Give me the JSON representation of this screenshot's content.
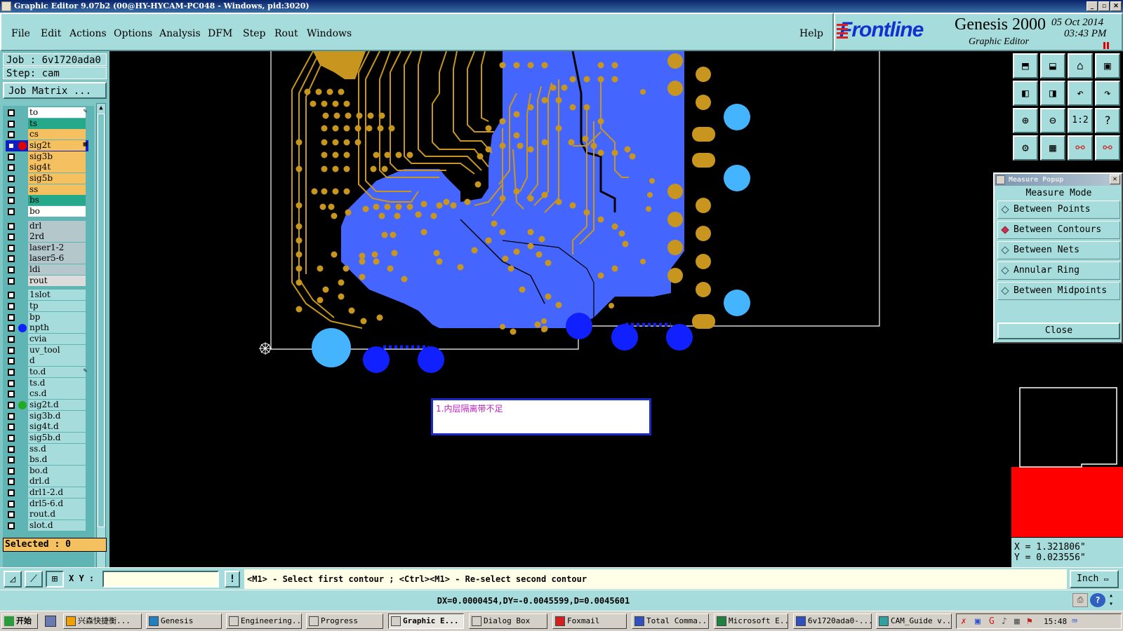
{
  "title_bar": {
    "text": "Graphic Editor 9.07b2 (00@HY-HYCAM-PC048 - Windows, pid:3020)"
  },
  "menu": {
    "items": [
      "File",
      "Edit",
      "Actions",
      "Options",
      "Analysis",
      "DFM",
      "Step",
      "Rout",
      "Windows"
    ],
    "help": "Help"
  },
  "logo": {
    "brand": "Frontline",
    "product": "Genesis 2000",
    "subtitle": "Graphic Editor",
    "date": "05 Oct 2014",
    "time": "03:43 PM"
  },
  "job": {
    "job_label": "Job : 6v1720ada0",
    "step_label": "Step: cam",
    "matrix_button": "Job Matrix ..."
  },
  "layers": [
    {
      "name": "to",
      "color": "#ffffff",
      "dot": null,
      "mark": "pen"
    },
    {
      "name": "ts",
      "color": "#26a88a",
      "dot": null
    },
    {
      "name": "cs",
      "color": "#f4c060",
      "dot": null
    },
    {
      "name": "sig2t",
      "color": "#f4c060",
      "dot": "#e00000",
      "mark": "grid",
      "work": true
    },
    {
      "name": "sig3b",
      "color": "#f4c060",
      "dot": null
    },
    {
      "name": "sig4t",
      "color": "#f4c060",
      "dot": null
    },
    {
      "name": "sig5b",
      "color": "#f4c060",
      "dot": null
    },
    {
      "name": "ss",
      "color": "#f4c060",
      "dot": null
    },
    {
      "name": "bs",
      "color": "#26a88a",
      "dot": null
    },
    {
      "name": "bo",
      "color": "#ffffff",
      "dot": null
    },
    {
      "name": "drl",
      "color": "#b4c8cc",
      "dot": null,
      "gap": true
    },
    {
      "name": "2rd",
      "color": "#b4c8cc",
      "dot": null
    },
    {
      "name": "laser1-2",
      "color": "#b4c8cc",
      "dot": null
    },
    {
      "name": "laser5-6",
      "color": "#b4c8cc",
      "dot": null
    },
    {
      "name": "ldi",
      "color": "#b4c8cc",
      "dot": null
    },
    {
      "name": "rout",
      "color": "#dcdcdc",
      "dot": null
    },
    {
      "name": "1slot",
      "color": "#a6dcdc",
      "dot": null,
      "gap": true
    },
    {
      "name": "tp",
      "color": "#a6dcdc",
      "dot": null
    },
    {
      "name": "bp",
      "color": "#a6dcdc",
      "dot": null
    },
    {
      "name": "npth",
      "color": "#a6dcdc",
      "dot": "#1020ff"
    },
    {
      "name": "cvia",
      "color": "#a6dcdc",
      "dot": null
    },
    {
      "name": "uv_tool",
      "color": "#a6dcdc",
      "dot": null
    },
    {
      "name": "d",
      "color": "#a6dcdc",
      "dot": null
    },
    {
      "name": "to.d",
      "color": "#a6dcdc",
      "dot": null,
      "mark": "pen"
    },
    {
      "name": "ts.d",
      "color": "#a6dcdc",
      "dot": null
    },
    {
      "name": "cs.d",
      "color": "#a6dcdc",
      "dot": null
    },
    {
      "name": "sig2t.d",
      "color": "#a6dcdc",
      "dot": "#22aa22"
    },
    {
      "name": "sig3b.d",
      "color": "#a6dcdc",
      "dot": null
    },
    {
      "name": "sig4t.d",
      "color": "#a6dcdc",
      "dot": null
    },
    {
      "name": "sig5b.d",
      "color": "#a6dcdc",
      "dot": null
    },
    {
      "name": "ss.d",
      "color": "#a6dcdc",
      "dot": null
    },
    {
      "name": "bs.d",
      "color": "#a6dcdc",
      "dot": null
    },
    {
      "name": "bo.d",
      "color": "#a6dcdc",
      "dot": null
    },
    {
      "name": "drl.d",
      "color": "#a6dcdc",
      "dot": null
    },
    {
      "name": "drl1-2.d",
      "color": "#a6dcdc",
      "dot": null
    },
    {
      "name": "drl5-6.d",
      "color": "#a6dcdc",
      "dot": null
    },
    {
      "name": "rout.d",
      "color": "#a6dcdc",
      "dot": null
    },
    {
      "name": "slot.d",
      "color": "#a6dcdc",
      "dot": null
    }
  ],
  "selected": "Selected : 0",
  "note": {
    "text": "1.内层隔离带不足"
  },
  "measure": {
    "title": "Measure Popup",
    "mode_label": "Measure Mode",
    "options": [
      {
        "label": "Between Points",
        "selected": false
      },
      {
        "label": "Between Contours",
        "selected": true
      },
      {
        "label": "Between Nets",
        "selected": false
      },
      {
        "label": "Annular Ring",
        "selected": false
      },
      {
        "label": "Between Midpoints",
        "selected": false
      }
    ],
    "close": "Close"
  },
  "toolbar_icons": [
    "zoom-page-icon",
    "zoom-fit-icon",
    "home-icon",
    "window-icon",
    "pan-left-icon",
    "pan-right-icon",
    "undo-view-icon",
    "redo-view-icon",
    "zoom-in-icon",
    "zoom-out-icon",
    "one-to-one-icon",
    "help-icon",
    "display-settings-icon",
    "grid-icon",
    "snap-icon",
    "measure-icon"
  ],
  "toolbar_labels": {
    "one_to_one": "1:2",
    "help": "?"
  },
  "coords": {
    "x": "X = 1.321806\"",
    "y": "Y = 0.023556\""
  },
  "status": {
    "xy_label": "X Y :",
    "xy_value": "",
    "prompt": "<M1> - Select first contour ; <Ctrl><M1> - Re-select second contour",
    "units": "Inch"
  },
  "dx_line": "DX=0.0000454,DY=-0.0045599,D=0.0045601",
  "taskbar": {
    "start": "开始",
    "tasks": [
      "兴森快捷衡...",
      "Genesis",
      "Engineering...",
      "Progress",
      "Graphic E...",
      "Dialog Box",
      "Foxmail",
      "Total Comma...",
      "Microsoft E...",
      "6v1720ada0-...",
      "CAM_Guide v..."
    ],
    "active_index": 4,
    "clock": "15:48"
  },
  "colors": {
    "panel": "#a6dcdc",
    "signal": "#c8961e",
    "copper_fill": "#4466ff",
    "npth": "#1020ff",
    "pad_light": "#44b4ff",
    "profile": "#ffffff",
    "overview_fill": "#ff0000"
  }
}
